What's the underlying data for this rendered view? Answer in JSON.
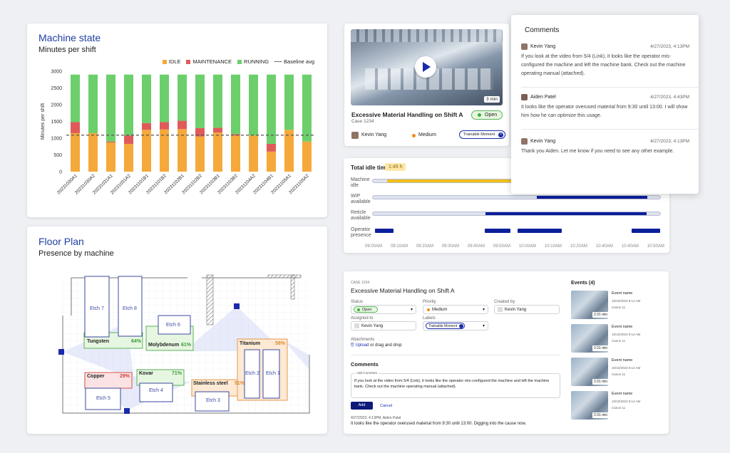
{
  "machine_state": {
    "title": "Machine state",
    "subtitle": "Minutes per shift",
    "legend": {
      "idle": "IDLE",
      "maintenance": "MAINTENANCE",
      "running": "RUNNING",
      "baseline": "Baseline avg"
    },
    "colors": {
      "idle": "#f5a93a",
      "maintenance": "#e05a5a",
      "running": "#6ccf6c",
      "baseline": "#555555"
    },
    "chart_data": {
      "type": "bar",
      "title": "Machine state",
      "subtitle": "Minutes per shift",
      "ylabel": "Minutes per shift",
      "ylim": [
        0,
        3000
      ],
      "yticks": [
        0,
        500,
        1000,
        1500,
        2000,
        2500,
        3000
      ],
      "categories": [
        "20231030A1",
        "20231030A2",
        "20231031A1",
        "20231031A2",
        "20231101B1",
        "20231101B2",
        "20231102B1",
        "20231102B2",
        "20231103B1",
        "20231103B2",
        "20231104A2",
        "20231104B1",
        "20231105A1",
        "20231105A2"
      ],
      "series": [
        {
          "name": "IDLE",
          "values": [
            1150,
            1150,
            870,
            830,
            1250,
            1260,
            1270,
            1050,
            1170,
            1080,
            1080,
            600,
            1250,
            900
          ]
        },
        {
          "name": "MAINTENANCE",
          "values": [
            330,
            0,
            30,
            250,
            200,
            220,
            250,
            250,
            140,
            40,
            0,
            230,
            0,
            0
          ]
        },
        {
          "name": "RUNNING",
          "values": [
            1420,
            1750,
            2000,
            1820,
            1450,
            1420,
            1380,
            1600,
            1590,
            1780,
            1820,
            2070,
            1650,
            2000
          ]
        }
      ],
      "baseline": {
        "name": "Baseline avg",
        "value": 1090
      },
      "legend_position": "top-right",
      "grid": false
    }
  },
  "floor_plan": {
    "title": "Floor Plan",
    "subtitle": "Presence by machine",
    "rooms": [
      {
        "name": "Etch 7"
      },
      {
        "name": "Etch 8"
      },
      {
        "name": "Etch 6"
      },
      {
        "name": "Etch 5"
      },
      {
        "name": "Etch 4"
      },
      {
        "name": "Etch 3"
      },
      {
        "name": "Etch 2"
      },
      {
        "name": "Etch 1"
      }
    ],
    "zones": [
      {
        "name": "Tungsten",
        "pct": "64%"
      },
      {
        "name": "Molybdenum",
        "pct": "61%"
      },
      {
        "name": "Copper",
        "pct": "29%"
      },
      {
        "name": "Kovar",
        "pct": "71%"
      },
      {
        "name": "Stainless steel",
        "pct": "51%"
      },
      {
        "name": "Titanium",
        "pct": "58%"
      }
    ]
  },
  "video_card": {
    "duration": "3 min",
    "title": "Excessive Material Handling on Shift A",
    "case": "Case 1234",
    "status": "Open",
    "user": "Kevin Yang",
    "priority": "Medium",
    "tag": "Trainable Moment"
  },
  "comments_popup": {
    "title": "Comments",
    "items": [
      {
        "author": "Kevin Yang",
        "time": "4/27/2023, 4:13PM",
        "text": "If you look at the video from 5/4 (Link), it looks like the operator mis-configured the machine and left the machine bank. Check out the machine operating manual (attached)."
      },
      {
        "author": "Aiden Patel",
        "time": "4/27/2023, 4:43PM",
        "text": "It looks like the operator overused material from 9:30 until 13:00. I will show him how he can optimize this usage."
      },
      {
        "author": "Kevin Yang",
        "time": "4/27/2023, 4:13PM",
        "text": "Thank you Aiden. Let me know if you need to see any other example."
      }
    ]
  },
  "idle_card": {
    "title": "Total idle time",
    "badge": "1:49 h",
    "rows": [
      "Machine idle",
      "WIP available",
      "Reticle available",
      "Operator presence"
    ],
    "times": [
      "09:00AM",
      "09:10AM",
      "09:20AM",
      "09:30AM",
      "09:40AM",
      "09:50AM",
      "10:00AM",
      "10:10AM",
      "10:20AM",
      "10:40AM",
      "10:40AM",
      "10:50AM"
    ]
  },
  "case_detail": {
    "case_label": "CASE 1234",
    "title": "Excessive Material Handling on Shift A",
    "status_label": "Status",
    "status": "Open",
    "priority_label": "Priority",
    "priority": "Medium",
    "created_label": "Created by",
    "created_by": "Kevin Yang",
    "assigned_label": "Assigned to",
    "assigned_to": "Kevin Yang",
    "labels_label": "Labels",
    "label_value": "Trainable Moment",
    "attachments_label": "Attachments",
    "upload": "Upload",
    "upload_rest": "or drag and drop",
    "comments_title": "Comments",
    "add_comment_label": "Add Comment",
    "comment_text": "If you look at the video from 5/4 (Link), it looks like the operator mis-configured the machine and left the machine bank. Check out the machine operating manual (attached).",
    "add_button": "Add",
    "cancel_button": "Cancel",
    "posted_meta": "4/27/2023, 4:13PM, Aiden Patel",
    "posted_text": "It looks like the operator overused material from 9:30 until 13:00. Digging into the cause now.",
    "events_title": "Events (4)",
    "events": [
      {
        "name": "Event name",
        "date": "10/10/2023 9:14 AM",
        "camera": "Canon 11",
        "duration": "2:31 min"
      },
      {
        "name": "Event name",
        "date": "10/10/2023 9:14 AM",
        "camera": "Canon 11",
        "duration": "2:31 min"
      },
      {
        "name": "Event name",
        "date": "10/10/2023 9:14 AM",
        "camera": "Canon 11",
        "duration": "2:31 min"
      },
      {
        "name": "Event name",
        "date": "10/10/2023 9:14 AM",
        "camera": "Canon 11",
        "duration": "2:31 min"
      }
    ]
  }
}
